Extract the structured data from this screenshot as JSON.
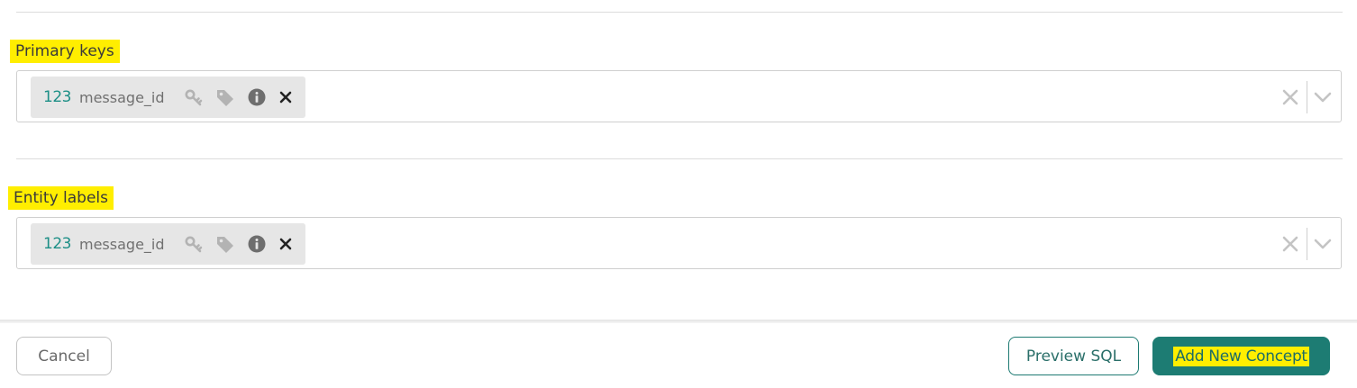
{
  "primary_keys": {
    "label": "Primary keys",
    "chip": {
      "type_label": "123",
      "name": "message_id",
      "icons": [
        "key-icon",
        "tag-icon",
        "info-icon",
        "close-icon"
      ]
    }
  },
  "entity_labels": {
    "label": "Entity labels",
    "chip": {
      "type_label": "123",
      "name": "message_id",
      "icons": [
        "key-icon",
        "tag-icon",
        "info-icon",
        "close-icon"
      ]
    }
  },
  "footer": {
    "cancel_label": "Cancel",
    "preview_label": "Preview SQL",
    "add_label": "Add New Concept"
  },
  "colors": {
    "accent": "#1d7c73",
    "highlight": "#ffee00",
    "chip_bg": "#e6e6e6",
    "type_text": "#1d8f86"
  }
}
